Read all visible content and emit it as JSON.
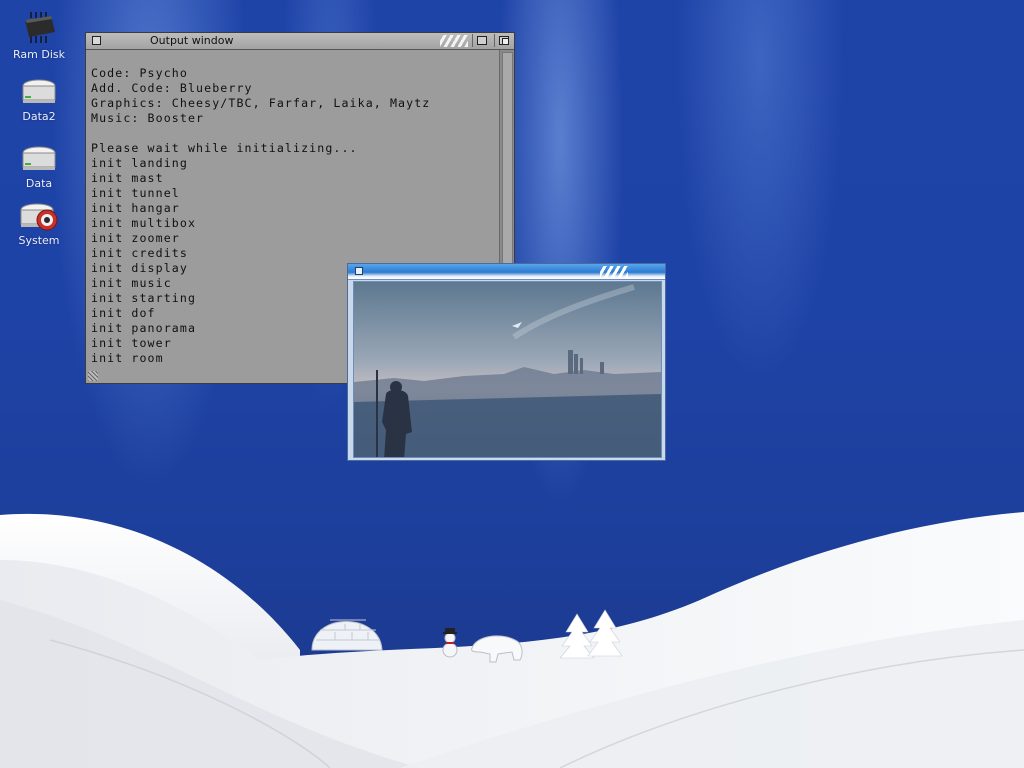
{
  "desktop": {
    "icons": [
      {
        "label": "Ram Disk",
        "icon": "memory-chip-icon"
      },
      {
        "label": "Data2",
        "icon": "hard-drive-icon"
      },
      {
        "label": "Data",
        "icon": "hard-drive-icon"
      },
      {
        "label": "System",
        "icon": "system-drive-icon"
      }
    ],
    "colors": {
      "background": "#1e43a6",
      "snow": "#f2f3f6"
    }
  },
  "output_window": {
    "title": "Output window",
    "lines": [
      "Code: Psycho",
      "Add. Code: Blueberry",
      "Graphics: Cheesy/TBC, Farfar, Laika, Maytz",
      "Music: Booster",
      "",
      "Please wait while initializing...",
      "init landing",
      "init mast",
      "init tunnel",
      "init hangar",
      "init multibox",
      "init zoomer",
      "init credits",
      "init display",
      "init music",
      "init starting",
      "init dof",
      "init panorama",
      "init tower",
      "init room"
    ]
  },
  "image_window": {
    "title": "",
    "scene": "misty-landscape-with-figure"
  }
}
